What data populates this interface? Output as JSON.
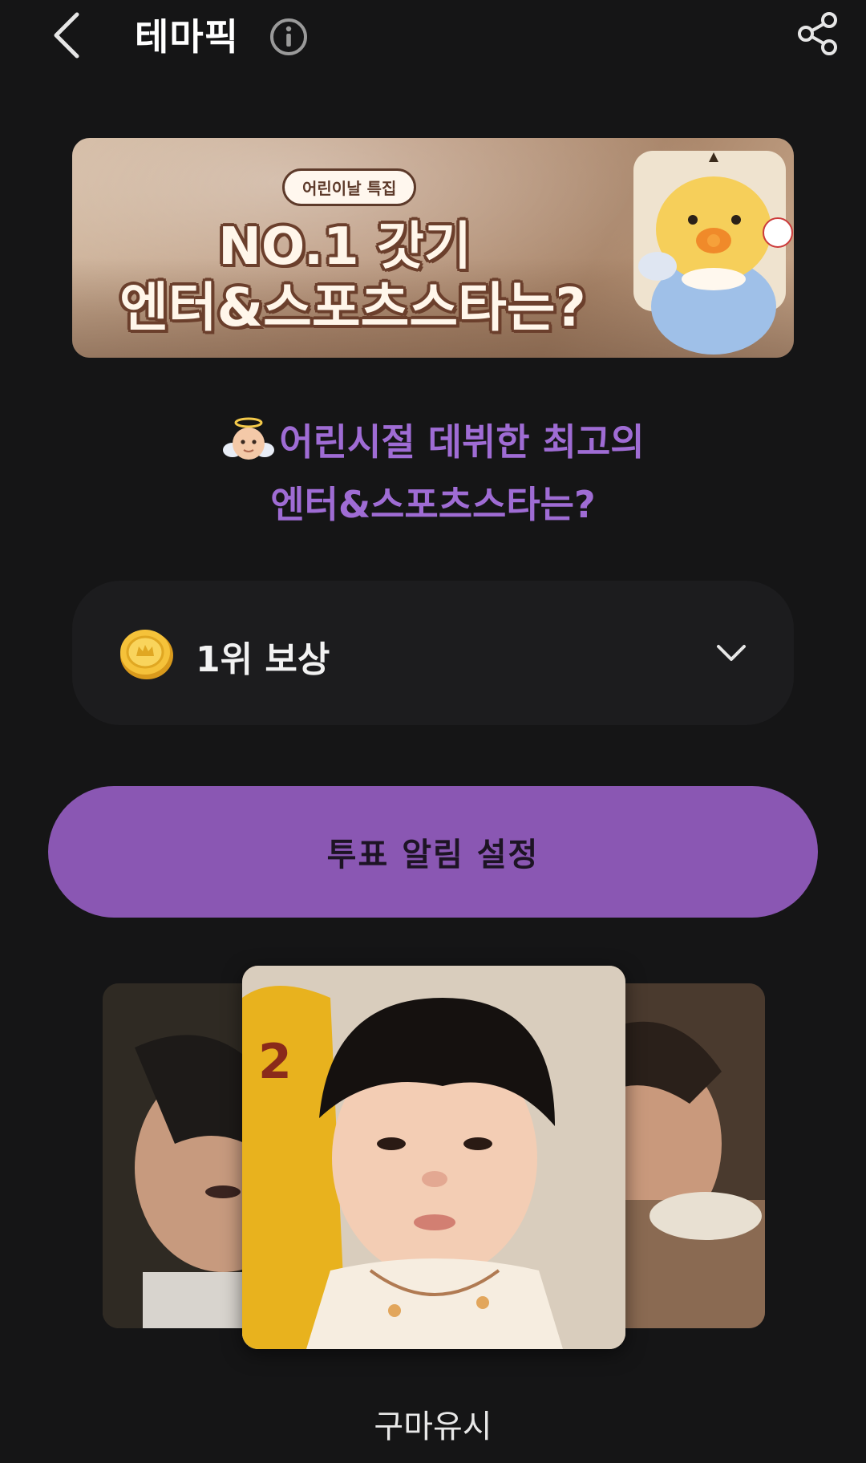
{
  "header": {
    "title": "테마픽",
    "back_icon": "chevron-left-icon",
    "info_icon": "info-icon",
    "share_icon": "share-icon"
  },
  "banner": {
    "badge": "어린이날 특집",
    "line1": "NO.1 갓기",
    "line2": "엔터&스포츠스타는?"
  },
  "heading": {
    "line1": "어린시절 데뷔한 최고의",
    "line2": "엔터&스포츠스타는?",
    "emoji_icon": "baby-angel-icon",
    "color": "#9f6cd4"
  },
  "reward": {
    "label": "1위 보상",
    "coin_icon": "coin-icon",
    "expand_icon": "chevron-down-icon"
  },
  "notify": {
    "label": "투표 알림 설정",
    "color": "#8a57b3"
  },
  "carousel": {
    "current_name": "구마유시"
  }
}
